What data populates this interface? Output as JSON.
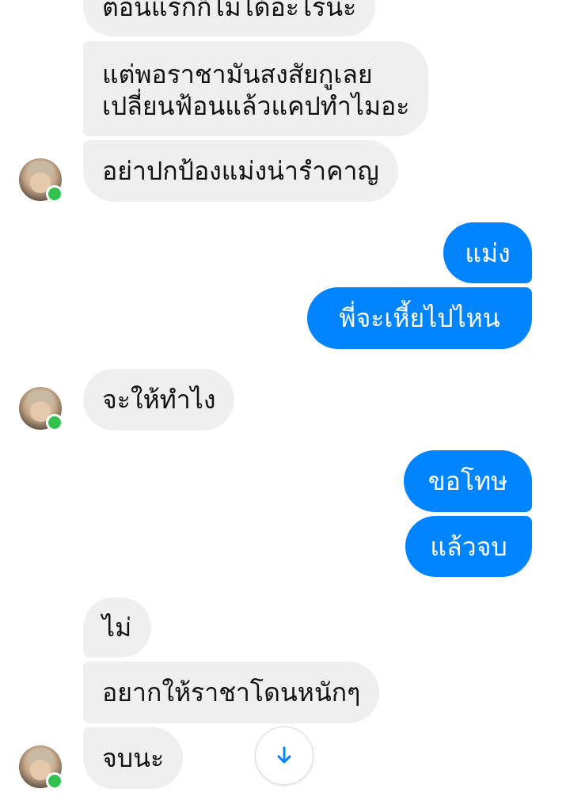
{
  "colors": {
    "incoming_bubble": "#efeff0",
    "outgoing_bubble": "#0084ff",
    "online_dot": "#31c24d"
  },
  "messages": [
    {
      "sender": "contact",
      "lines": [
        "ตอนแรกก็ไม่ได้อะไรนะ"
      ]
    },
    {
      "sender": "contact",
      "lines": [
        "แต่พอราชามันสงสัยกูเลย",
        "เปลี่ยนฟ้อนแล้วแคปทำไมอะ"
      ]
    },
    {
      "sender": "contact",
      "lines": [
        "อย่าปกป้องแม่งน่ารำคาญ"
      ]
    },
    {
      "sender": "me",
      "lines": [
        "แม่ง"
      ]
    },
    {
      "sender": "me",
      "lines": [
        "พี่จะเหี้ยไปไหน"
      ]
    },
    {
      "sender": "contact",
      "lines": [
        "จะให้ทำไง"
      ]
    },
    {
      "sender": "me",
      "lines": [
        "ขอโทษ"
      ]
    },
    {
      "sender": "me",
      "lines": [
        "แล้วจบ"
      ]
    },
    {
      "sender": "contact",
      "lines": [
        "ไม่"
      ]
    },
    {
      "sender": "contact",
      "lines": [
        "อยากให้ราชาโดนหนักๆ"
      ]
    },
    {
      "sender": "contact",
      "lines": [
        "จบนะ"
      ]
    }
  ],
  "icons": {
    "avatar": "contact-avatar",
    "online_status": "online-dot",
    "scroll_down": "arrow-down-icon"
  }
}
